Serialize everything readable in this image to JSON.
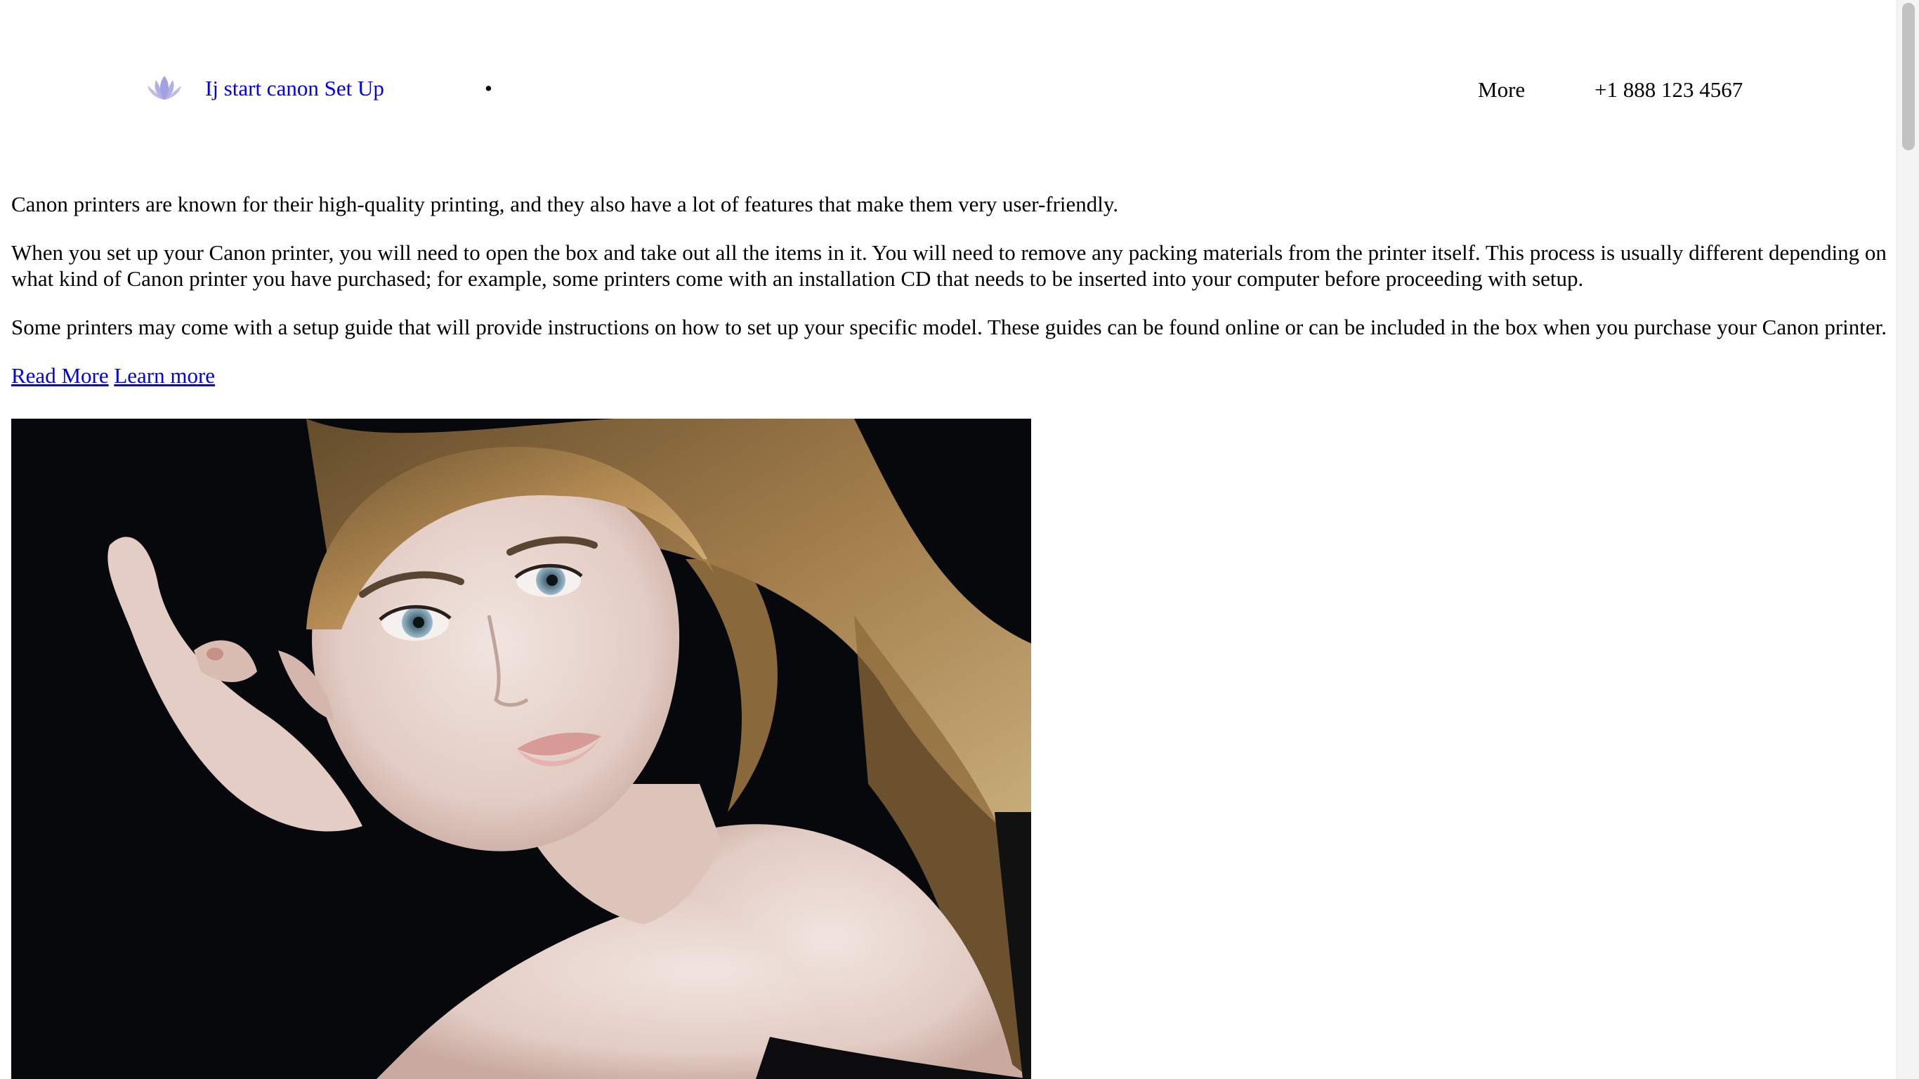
{
  "header": {
    "logo_text": "Ij start canon Set Up",
    "logo_icon": "lotus-icon",
    "nav_bullet": "•",
    "more_label": "More",
    "phone": "+1 888 123 4567"
  },
  "content": {
    "paragraphs": [
      "Canon printers are known for their high-quality printing, and they also have a lot of features that make them very user-friendly.",
      "When you set up your Canon printer, you will need to open the box and take out all the items in it. You will need to remove any packing materials from the printer itself. This process is usually different depending on what kind of Canon printer you have purchased; for example, some printers come with an installation CD that needs to be inserted into your computer before proceeding with setup.",
      "Some printers may come with a setup guide that will provide instructions on how to set up your specific model. These guides can be found online or can be included in the box when you purchase your Canon printer."
    ],
    "read_more_label": "Read More",
    "learn_more_label": "Learn more"
  },
  "colors": {
    "link": "#0000ee",
    "logo_icon": "#9f9ce0",
    "image_background": "#07080c"
  }
}
